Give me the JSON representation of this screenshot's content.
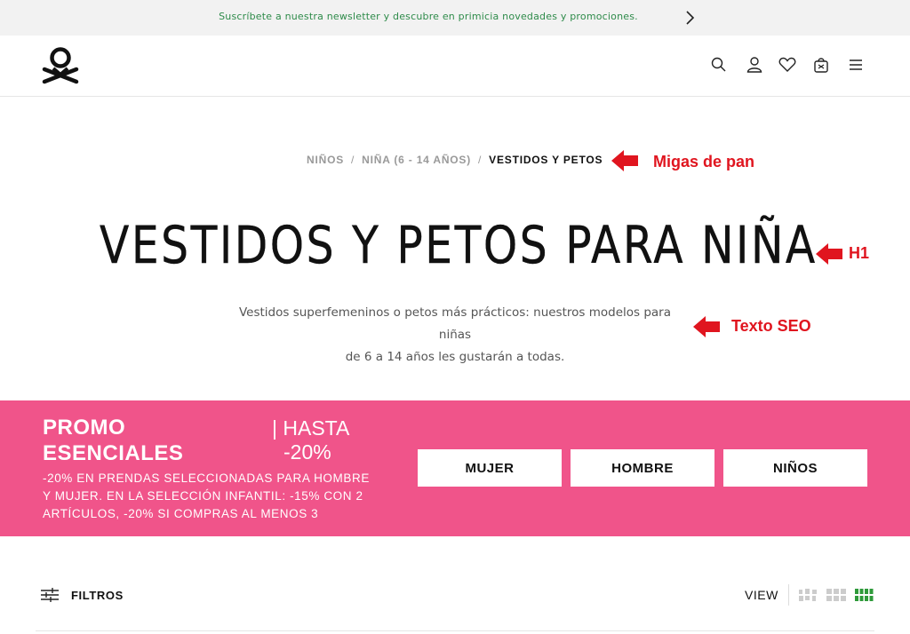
{
  "topbar": {
    "text": "Suscríbete a nuestra newsletter y descubre en primicia novedades y promociones.",
    "arrow_icon": "chevron-right-icon"
  },
  "header": {
    "logo": "benetton-logo",
    "icons": [
      "search-icon",
      "user-icon",
      "heart-icon",
      "bag-icon",
      "menu-icon"
    ]
  },
  "breadcrumb": {
    "items": [
      "NIÑOS",
      "NIÑA (6 - 14 AÑOS)"
    ],
    "separator": "/",
    "current": "VESTIDOS Y PETOS"
  },
  "title": "VESTIDOS Y PETOS PARA NIÑA",
  "seo_text": {
    "line1": "Vestidos superfemeninos o petos más prácticos: nuestros modelos para niñas",
    "line2": "de 6 a 14 años les gustarán a todas."
  },
  "annotations": {
    "breadcrumb": "Migas de pan",
    "h1": "H1",
    "seo": "Texto SEO",
    "color": "#e0151f"
  },
  "promo": {
    "title_line1": "PROMO",
    "title_line2": "ESENCIALES",
    "hasta_line1": "| HASTA",
    "hasta_line2": "-20%",
    "description": "-20% EN PRENDAS SELECCIONADAS PARA HOMBRE Y MUJER. EN LA SELECCIÓN INFANTIL: -15% CON 2 ARTÍCULOS, -20% SI COMPRAS AL MENOS 3",
    "buttons": [
      "MUJER",
      "HOMBRE",
      "NIÑOS"
    ],
    "background": "#f0548a"
  },
  "toolbar": {
    "filters_label": "FILTROS",
    "view_label": "VIEW",
    "view_options": [
      "grid-large-icon",
      "grid-medium-icon",
      "grid-small-icon"
    ],
    "active_view": "grid-small-icon",
    "active_color": "#2e9a3a"
  }
}
